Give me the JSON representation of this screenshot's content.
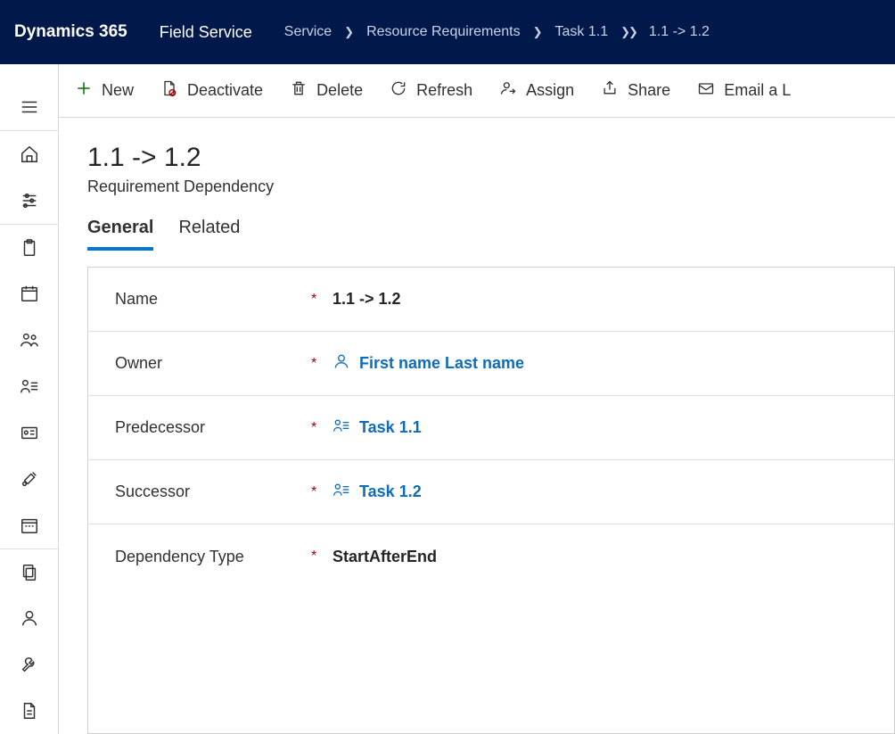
{
  "header": {
    "product": "Dynamics 365",
    "app": "Field Service",
    "breadcrumb": {
      "root": "Service",
      "parent": "Resource Requirements",
      "item": "Task 1.1",
      "current": "1.1 -> 1.2"
    }
  },
  "commands": {
    "new": "New",
    "deactivate": "Deactivate",
    "delete": "Delete",
    "refresh": "Refresh",
    "assign": "Assign",
    "share": "Share",
    "email": "Email a L"
  },
  "record": {
    "title": "1.1 -> 1.2",
    "subtitle": "Requirement Dependency"
  },
  "tabs": {
    "general": "General",
    "related": "Related"
  },
  "form": {
    "name": {
      "label": "Name",
      "value": "1.1 -> 1.2"
    },
    "owner": {
      "label": "Owner",
      "value": "First name Last name"
    },
    "predecessor": {
      "label": "Predecessor",
      "value": "Task 1.1"
    },
    "successor": {
      "label": "Successor",
      "value": "Task 1.2"
    },
    "dependency_type": {
      "label": "Dependency Type",
      "value": "StartAfterEnd"
    }
  }
}
